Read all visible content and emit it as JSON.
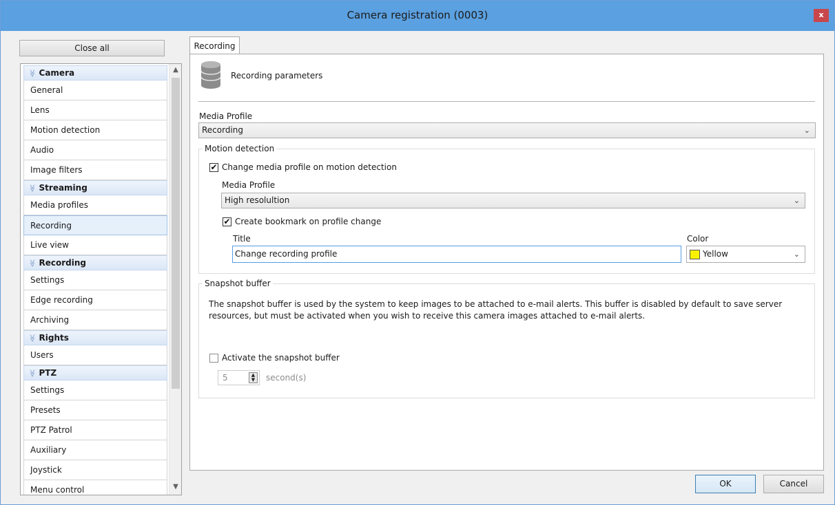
{
  "window": {
    "title": "Camera registration (0003)",
    "close_glyph": "x"
  },
  "sidebar": {
    "close_all_label": "Close all",
    "groups": [
      {
        "label": "Camera",
        "items": [
          "General",
          "Lens",
          "Motion detection",
          "Audio",
          "Image filters"
        ]
      },
      {
        "label": "Streaming",
        "items": [
          "Media profiles",
          "Recording",
          "Live view"
        ]
      },
      {
        "label": "Recording",
        "items": [
          "Settings",
          "Edge recording",
          "Archiving"
        ]
      },
      {
        "label": "Rights",
        "items": [
          "Users"
        ]
      },
      {
        "label": "PTZ",
        "items": [
          "Settings",
          "Presets",
          "PTZ Patrol",
          "Auxiliary",
          "Joystick",
          "Menu control"
        ]
      }
    ],
    "selected": "Streaming/Recording"
  },
  "tab": {
    "label": "Recording"
  },
  "header": {
    "title": "Recording parameters",
    "icon": "database-icon"
  },
  "media_profile": {
    "label": "Media Profile",
    "value": "Recording"
  },
  "motion": {
    "group_title": "Motion detection",
    "change_profile": {
      "label": "Change media profile on motion detection",
      "checked": true
    },
    "profile_label": "Media Profile",
    "profile_value": "High resolultion",
    "bookmark": {
      "label": "Create bookmark on profile change",
      "checked": true
    },
    "title_label": "Title",
    "title_value": "Change recording profile",
    "color_label": "Color",
    "color_value": "Yellow",
    "color_hex": "#f8f200"
  },
  "snapshot": {
    "group_title": "Snapshot buffer",
    "description": "The snapshot buffer is used by the system to keep images to be attached to e-mail alerts. This buffer is disabled by default to save server resources, but must be activated when you wish to receive this camera images attached to e-mail alerts.",
    "activate_label": "Activate the snapshot buffer",
    "activate_checked": false,
    "seconds_value": "5",
    "seconds_unit": "second(s)"
  },
  "footer": {
    "ok_label": "OK",
    "cancel_label": "Cancel"
  },
  "colors": {
    "titlebar": "#5ba0e0",
    "close_button": "#c9474b",
    "selected_item": "#e6f0fb",
    "group_header": "#dbe7f7"
  }
}
